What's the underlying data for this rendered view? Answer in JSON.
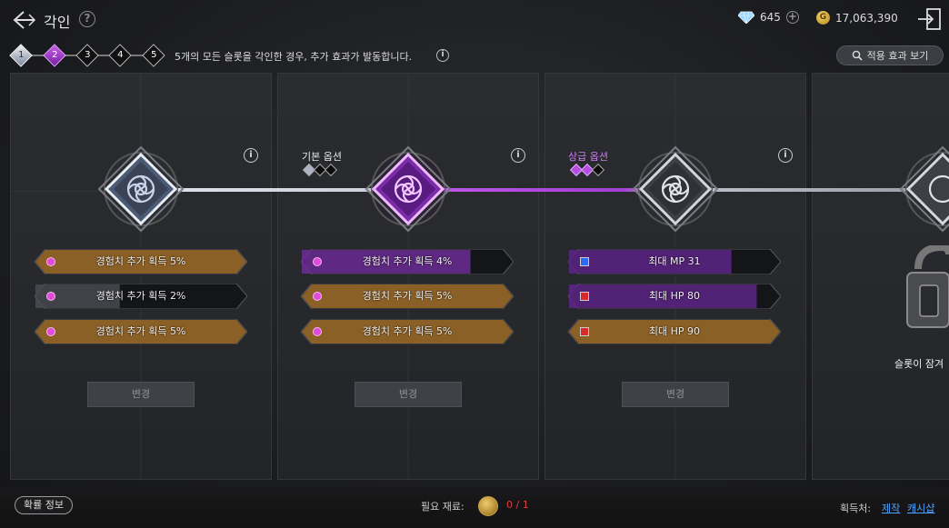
{
  "header": {
    "title": "각인",
    "gem_count": "645",
    "gold_count": "17,063,390",
    "gold_symbol": "G"
  },
  "steps": {
    "items": [
      "1",
      "2",
      "3",
      "4",
      "5"
    ],
    "description": "5개의 모든 슬롯을 각인한 경우, 추가 효과가 발동합니다.",
    "effect_button": "적용 효과 보기"
  },
  "panels": [
    {
      "label": "",
      "options": [
        {
          "text": "경험치 추가 획득 5%",
          "fill": 1.0
        },
        {
          "text": "경험치 추가 획득 2%",
          "fill": 0.4
        },
        {
          "text": "경험치 추가 획득 5%",
          "fill": 1.0
        }
      ],
      "change_label": "변경"
    },
    {
      "label": "기본 옵션",
      "options": [
        {
          "text": "경험치 추가 획득 4%",
          "fill": 0.8
        },
        {
          "text": "경험치 추가 획득 5%",
          "fill": 1.0
        },
        {
          "text": "경험치 추가 획득 5%",
          "fill": 1.0
        }
      ],
      "change_label": "변경"
    },
    {
      "label": "상급 옵션",
      "options": [
        {
          "text": "최대 MP 31",
          "fill": 0.77
        },
        {
          "text": "최대 HP 80",
          "fill": 0.89
        },
        {
          "text": "최대 HP 90",
          "fill": 1.0
        }
      ],
      "change_label": "변경"
    }
  ],
  "locked_panel": {
    "text": "슬롯이 잠겨"
  },
  "bottom": {
    "probability_button": "확률 정보",
    "material_label": "필요 재료:",
    "material_count": "0 / 1",
    "acquire_label": "획득처:",
    "acquire_craft": "제작",
    "acquire_shop": "캐시샵"
  },
  "colors": {
    "purple": "#b34ee0",
    "gold": "#c8892b",
    "blue_option": "#2b6cf0",
    "red_option": "#d62b2b",
    "link": "#4fa3ff"
  }
}
